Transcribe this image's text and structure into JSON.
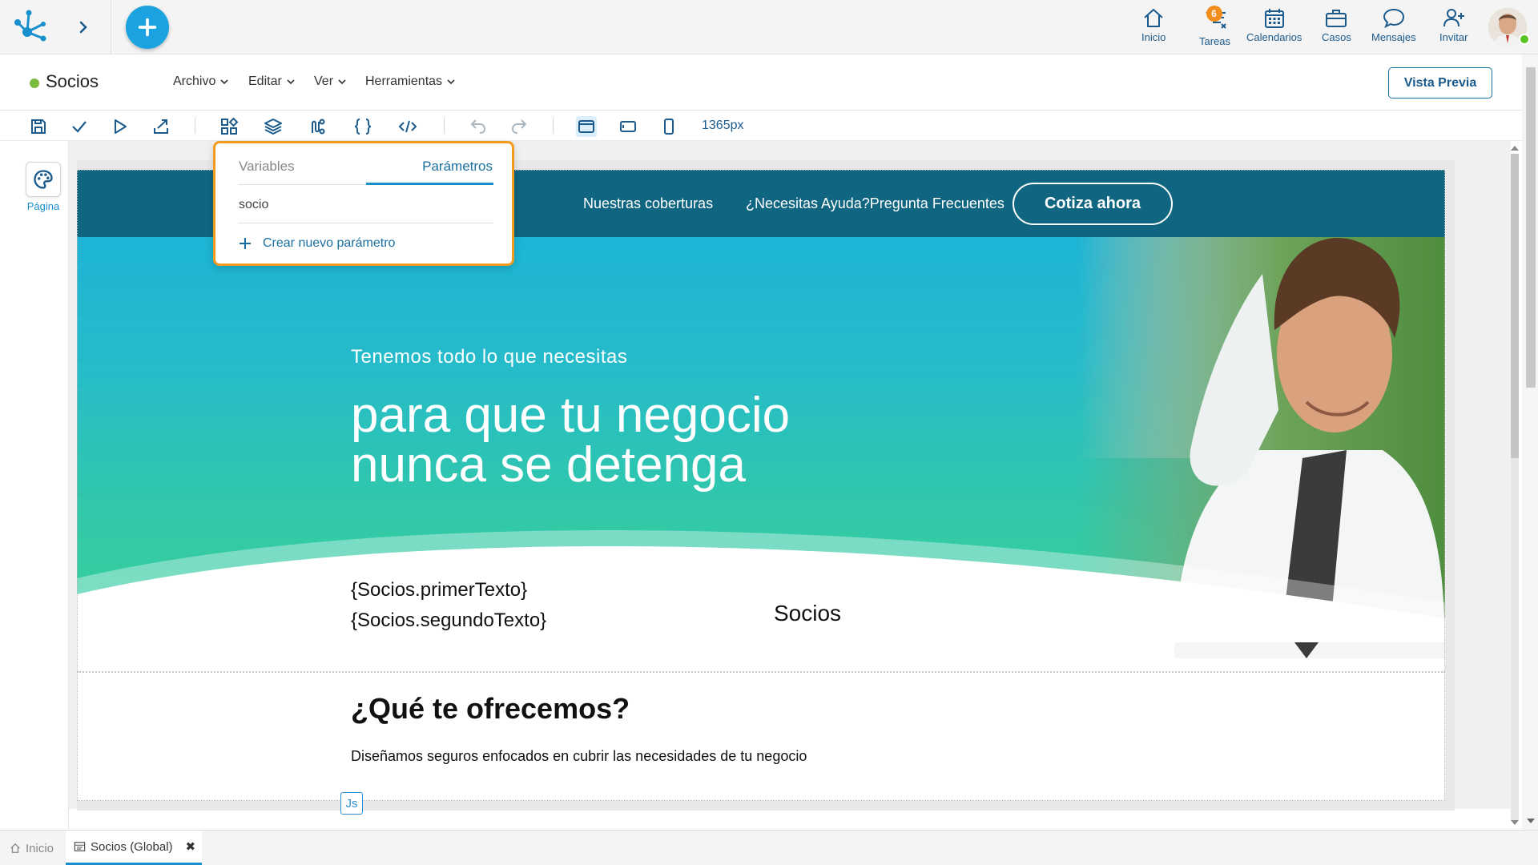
{
  "nav": {
    "items": [
      {
        "label": "Inicio",
        "icon": "home-icon"
      },
      {
        "label": "Tareas",
        "icon": "tasks-icon",
        "badge": "6"
      },
      {
        "label": "Calendarios",
        "icon": "calendar-icon"
      },
      {
        "label": "Casos",
        "icon": "briefcase-icon"
      },
      {
        "label": "Mensajes",
        "icon": "chat-icon"
      },
      {
        "label": "Invitar",
        "icon": "invite-user-icon"
      }
    ]
  },
  "document": {
    "title": "Socios",
    "status_color": "#79b93c"
  },
  "menu": {
    "items": [
      "Archivo",
      "Editar",
      "Ver",
      "Herramientas"
    ],
    "preview_label": "Vista Previa"
  },
  "toolbar": {
    "width_readout": "1365px"
  },
  "side_panel": {
    "page_label": "Página"
  },
  "popup": {
    "tabs": [
      "Variables",
      "Parámetros"
    ],
    "active_tab": "Parámetros",
    "items": [
      "socio"
    ],
    "new_label": "Crear nuevo parámetro"
  },
  "preview": {
    "nav_links": [
      "Nuestras coberturas",
      "¿Necesitas Ayuda?Pregunta Frecuentes"
    ],
    "cta_label": "Cotiza ahora",
    "hero_subtitle": "Tenemos todo lo que necesitas",
    "hero_title_line1": "para que tu negocio",
    "hero_title_line2": "nunca se detenga",
    "param_text_1": "{Socios.primerTexto}",
    "param_text_2": "{Socios.segundoTexto}",
    "socios_label": "Socios",
    "offer_title": "¿Qué te ofrecemos?",
    "offer_desc": "Diseñamos seguros enfocados en cubrir las necesidades de tu negocio",
    "js_badge": "Js"
  },
  "bottom_tabs": {
    "home": "Inicio",
    "active": "Socios (Global)"
  },
  "colors": {
    "accent": "#1aa3e0",
    "highlight_border": "#f29b1c",
    "hero_top": "#106681"
  }
}
